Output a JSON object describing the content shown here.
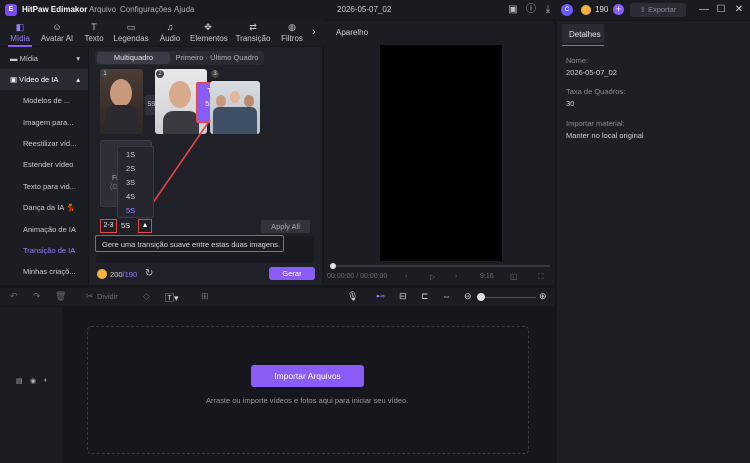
{
  "titlebar": {
    "app_name": "HitPaw Edimakor",
    "logo_text": "E",
    "menu": [
      "Arquivo",
      "Configurações",
      "Ajuda"
    ],
    "doc_title": "2026-05-07_02",
    "avatar_letter": "C",
    "credits": "190",
    "plus": "+",
    "export_label": "Exportar"
  },
  "toolbar": {
    "tabs": [
      {
        "label": "Mídia",
        "icon": "◧"
      },
      {
        "label": "Avatar AI",
        "icon": "☺"
      },
      {
        "label": "Texto",
        "icon": "T"
      },
      {
        "label": "Legendas",
        "icon": "▭"
      },
      {
        "label": "Áudio",
        "icon": "♫"
      },
      {
        "label": "Elementos",
        "icon": "✥"
      },
      {
        "label": "Transição",
        "icon": "⇄"
      },
      {
        "label": "Filtros",
        "icon": "◍"
      }
    ]
  },
  "sidebar": {
    "media": "Mídia",
    "video_ia": "Vídeo de IA",
    "items": [
      "Modelos de ...",
      "Imagem para...",
      "Reestilizar víd...",
      "Estender vídeo",
      "Texto para vid...",
      "Dança da IA 💃",
      "Animação de IA",
      "Transição de IA",
      "Minhas criaçõ..."
    ]
  },
  "panel": {
    "tab_multi": "Multiquadro",
    "tab_first_last": "Primeiro · Último Quadro",
    "card_numbers": [
      "1",
      "2",
      "3"
    ],
    "durations": [
      "5S",
      "5S"
    ],
    "frame_placeholder": "Fr",
    "frame_placeholder_sub": "(O",
    "dropdown_options": [
      "1S",
      "2S",
      "3S",
      "4S",
      "5S"
    ],
    "range_label": "2-3",
    "selected_duration": "5S",
    "apply_all": "Apply All",
    "prompt_text": "Gere uma transição suave entre estas duas imagens.",
    "credits_used": "200",
    "credits_total": "/190",
    "generate_label": "Gerar"
  },
  "preview": {
    "title": "Aparelho",
    "time": "00:00:00 / 00:00:00",
    "ratio": "9:16"
  },
  "details": {
    "tab": "Detalhes",
    "name_label": "Nome:",
    "name_value": "2026-05-07_02",
    "fps_label": "Taxa de Quadros:",
    "fps_value": "30",
    "import_label": "Importar material:",
    "import_value": "Manter no local original"
  },
  "timeline": {
    "split_label": "Dividir",
    "import_button": "Importar Arquivos",
    "hint": "Arraste ou importe vídeos e fotos aqui para iniciar seu vídeo."
  },
  "colors": {
    "accent": "#8a5cf6",
    "highlight": "#e64545"
  }
}
